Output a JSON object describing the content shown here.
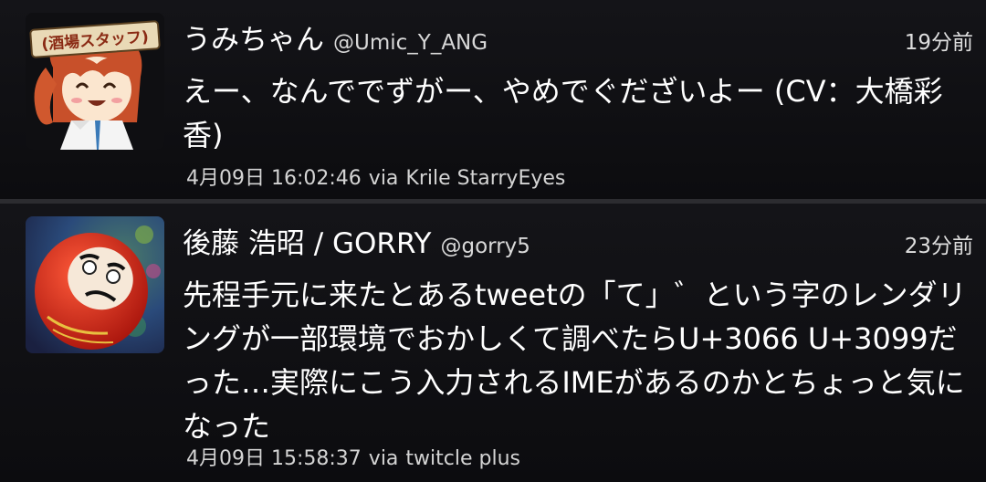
{
  "tweets": [
    {
      "display_name": "うみちゃん",
      "screen_name": "@Umic_Y_ANG",
      "time_ago": "19分前",
      "text": "えー、なんででずがー、やめでぐだざいよー (CV：大橋彩香)",
      "timestamp": "4月09日 16:02:46",
      "via_label": "via",
      "client": "Krile StarryEyes",
      "avatar_badge": "(酒場スタッフ)"
    },
    {
      "display_name": "後藤 浩昭 / GORRY",
      "screen_name": "@gorry5",
      "time_ago": "23分前",
      "text": "先程手元に来たとあるtweetの「て」゛という字のレンダリングが一部環境でおかしくて調べたらU+3066 U+3099だった…実際にこう入力されるIMEがあるのかとちょっと気になった",
      "timestamp": "4月09日 15:58:37",
      "via_label": "via",
      "client": "twitcle plus"
    }
  ],
  "colors": {
    "background": "#000000",
    "card": "#141418",
    "divider": "#2c2c30",
    "text_primary": "#ffffff",
    "text_secondary": "#d4d4d4"
  }
}
